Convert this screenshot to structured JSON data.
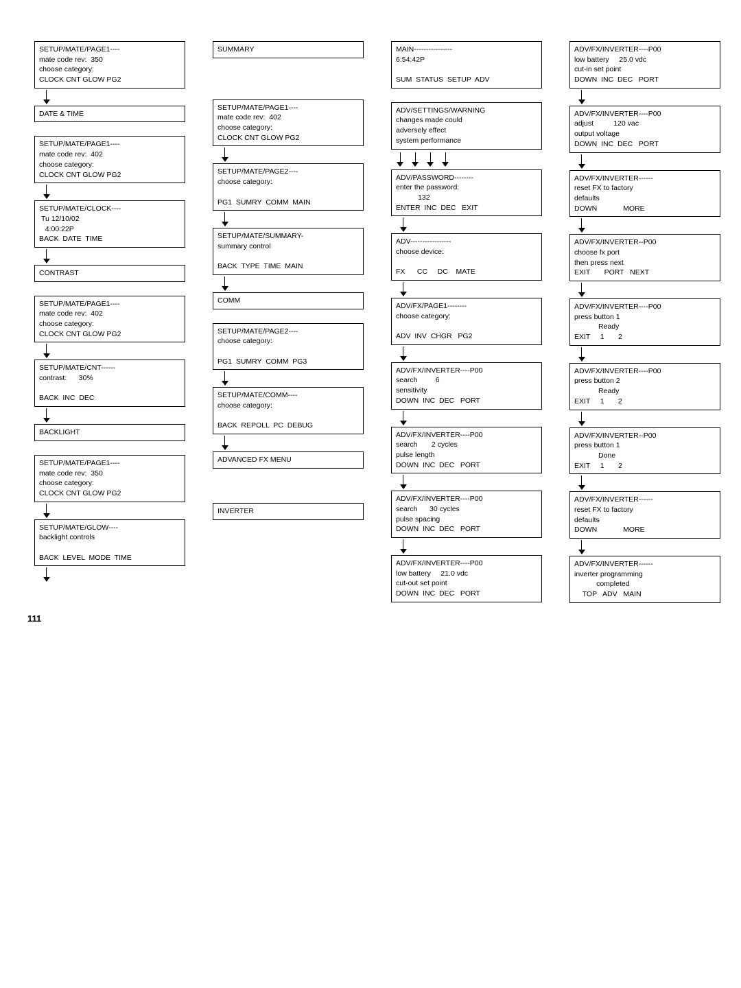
{
  "page_number": "111",
  "columns": [
    {
      "id": "col1",
      "items": [
        {
          "type": "box",
          "text": "SETUP/MATE/PAGE1----\nmate code rev:  350\nchoose category:\nCLOCK CNT GLOW PG2"
        },
        {
          "type": "arrow"
        },
        {
          "type": "box",
          "text": "DATE & TIME"
        },
        {
          "type": "spacer"
        },
        {
          "type": "box",
          "text": "SETUP/MATE/PAGE1----\nmate code rev:  402\nchoose category:\nCLOCK CNT GLOW PG2"
        },
        {
          "type": "arrow"
        },
        {
          "type": "box",
          "text": "SETUP/MATE/CLOCK----\nTu 12/10/02\n   4:00:22P\nBACK DATE  TIME"
        },
        {
          "type": "arrow"
        },
        {
          "type": "box",
          "text": "CONTRAST"
        },
        {
          "type": "spacer"
        },
        {
          "type": "box",
          "text": "SETUP/MATE/PAGE1----\nmate code rev:  402\nchoose category:\nCLOCK CNT GLOW PG2"
        },
        {
          "type": "arrow"
        },
        {
          "type": "box",
          "text": "SETUP/MATE/CNT------\ncontrast:     30%\n\nBACK  INC  DEC"
        },
        {
          "type": "arrow"
        },
        {
          "type": "box",
          "text": "BACKLIGHT"
        },
        {
          "type": "spacer"
        },
        {
          "type": "box",
          "text": "SETUP/MATE/PAGE1----\nmate code rev:  350\nchoose category:\nCLOCK CNT GLOW PG2"
        },
        {
          "type": "arrow"
        },
        {
          "type": "box",
          "text": "SETUP/MATE/GLOW----\nbacklight controls\n\nBACK  LEVEL  MODE  TIME"
        },
        {
          "type": "arrow"
        }
      ]
    },
    {
      "id": "col2",
      "items": [
        {
          "type": "box",
          "text": "SUMMARY"
        },
        {
          "type": "spacer"
        },
        {
          "type": "spacer"
        },
        {
          "type": "box",
          "text": "SETUP/MATE/PAGE1----\nmate code rev:  402\nchoose category:\nCLOCK CNT GLOW PG2"
        },
        {
          "type": "arrow"
        },
        {
          "type": "box",
          "text": "SETUP/MATE/PAGE2----\nchoose category:\n\nPG1  SUMRY  COMM  MAIN"
        },
        {
          "type": "arrow"
        },
        {
          "type": "box",
          "text": "SETUP/MATE/SUMMARY-\nsummary control\n\nBACK  TYPE  TIME  MAIN"
        },
        {
          "type": "arrow"
        },
        {
          "type": "box",
          "text": "COMM"
        },
        {
          "type": "spacer"
        },
        {
          "type": "box",
          "text": "SETUP/MATE/PAGE2----\nchoose category:\n\nPG1  SUMRY  COMM  PG3"
        },
        {
          "type": "arrow"
        },
        {
          "type": "box",
          "text": "SETUP/MATE/COMM----\nchoose category:\n\nBACK  REPOLL  PC  DEBUG"
        },
        {
          "type": "arrow"
        },
        {
          "type": "box",
          "text": "ADVANCED FX MENU"
        },
        {
          "type": "spacer"
        },
        {
          "type": "spacer"
        },
        {
          "type": "box",
          "text": "INVERTER"
        }
      ]
    },
    {
      "id": "col3",
      "items": [
        {
          "type": "box",
          "text": "MAIN----------------\n6:54:42P\n\nSUM  STATUS  SETUP  ADV"
        },
        {
          "type": "spacer"
        },
        {
          "type": "box",
          "text": "ADV/SETTINGS/WARNING\nchanges made could\nadversely effect\nsystem performance"
        },
        {
          "type": "multi-arrow",
          "count": 4
        },
        {
          "type": "box",
          "text": "ADV/PASSWORD--------\nenter the password:\n          132\nENTER  INC  DEC   EXIT"
        },
        {
          "type": "arrow"
        },
        {
          "type": "box",
          "text": "ADV-----------------\nchoose device:\n\nFX     CC     DC    MATE"
        },
        {
          "type": "arrow"
        },
        {
          "type": "box",
          "text": "ADV/FX/PAGE1--------\nchoose category:\n\nADV  INV  CHGR   PG2"
        },
        {
          "type": "arrow"
        },
        {
          "type": "box",
          "text": "ADV/FX/INVERTER----P00\nsearch          6\nsensitivity\nDOWN  INC  DEC   PORT"
        },
        {
          "type": "arrow"
        },
        {
          "type": "box",
          "text": "ADV/FX/INVERTER----P00\nsearch       2 cycles\npulse length\nDOWN  INC  DEC   PORT"
        },
        {
          "type": "arrow"
        },
        {
          "type": "box",
          "text": "ADV/FX/INVERTER----P00\nsearch      30 cycles\npulse spacing\nDOWN  INC  DEC   PORT"
        },
        {
          "type": "arrow"
        },
        {
          "type": "box",
          "text": "ADV/FX/INVERTER----P00\nlow battery     21.0 vdc\ncut-out set point\nDOWN  INC  DEC   PORT"
        }
      ]
    },
    {
      "id": "col4",
      "items": [
        {
          "type": "box",
          "text": "ADV/FX/INVERTER----P00\nlow battery     25.0 vdc\ncut-in set point\nDOWN  INC  DEC   PORT"
        },
        {
          "type": "arrow"
        },
        {
          "type": "box",
          "text": "ADV/FX/INVERTER----P00\nadjust          120 vac\noutput voltage\nDOWN  INC  DEC   PORT"
        },
        {
          "type": "arrow"
        },
        {
          "type": "box",
          "text": "ADV/FX/INVERTER------\nreset FX to factory\ndefaults\nDOWN            MORE"
        },
        {
          "type": "arrow"
        },
        {
          "type": "box",
          "text": "ADV/FX/INVERTER--P00\nchoose fx port\nthen press next\nEXIT      PORT   NEXT"
        },
        {
          "type": "arrow"
        },
        {
          "type": "box",
          "text": "ADV/FX/INVERTER----P00\npress button 1\n           Ready\nEXIT    1      2"
        },
        {
          "type": "arrow"
        },
        {
          "type": "box",
          "text": "ADV/FX/INVERTER----P00\npress button 2\n           Ready\nEXIT    1      2"
        },
        {
          "type": "arrow"
        },
        {
          "type": "box",
          "text": "ADV/FX/INVERTER--P00\npress button 1\n           Done\nEXIT    1      2"
        },
        {
          "type": "arrow"
        },
        {
          "type": "box",
          "text": "ADV/FX/INVERTER------\nreset FX to factory\ndefaults\nDOWN            MORE"
        },
        {
          "type": "arrow"
        },
        {
          "type": "box",
          "text": "ADV/FX/INVERTER------\ninverter programming\n          completed\n   TOP   ADV   MAIN"
        }
      ]
    }
  ]
}
